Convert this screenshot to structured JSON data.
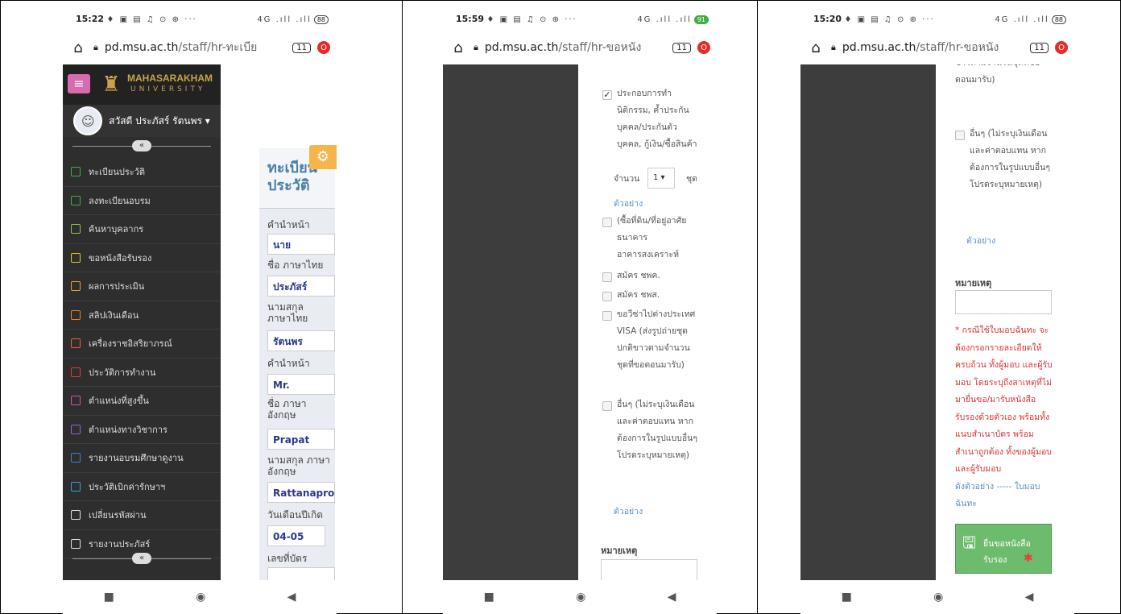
{
  "phones": [
    {
      "time": "15:22",
      "status_icons": "♦ ▣ ▤ ♫ ⊙ ⊕ ···",
      "signal": "4G .ıll .ıll",
      "battery": "88",
      "url_host": "pd.msu.ac.th",
      "url_path": "/staff/hr-ทะเบีย",
      "tab_count": "11"
    },
    {
      "time": "15:59",
      "status_icons": "♦ ▣ ▤ ♫ ⊙ ⊕ ···",
      "signal": "4G .ıll .ıll",
      "battery": "91",
      "url_host": "pd.msu.ac.th",
      "url_path": "/staff/hr-ขอหนัง",
      "tab_count": "11"
    },
    {
      "time": "15:20",
      "status_icons": "♦ ▣ ▤ ♫ ⊙ ⊕ ···",
      "signal": "4G .ıll .ıll",
      "battery": "88",
      "url_host": "pd.msu.ac.th",
      "url_path": "/staff/hr-ขอหนัง",
      "tab_count": "11"
    }
  ],
  "brand": {
    "name": "MAHASARAKHAM",
    "sub": "UNIVERSITY"
  },
  "user": {
    "greeting": "สวัสดี ประภัสร์ รัตนพร ▾"
  },
  "menu": [
    {
      "label": "ทะเบียนประวัติ",
      "color": "#3cb043"
    },
    {
      "label": "ลงทะเบียนอบรม",
      "color": "#3cb043"
    },
    {
      "label": "ค้นหาบุคลากร",
      "color": "#8bc34a"
    },
    {
      "label": "ขอหนังสือรับรอง",
      "color": "#e6c619"
    },
    {
      "label": "ผลการประเมิน",
      "color": "#f0a020"
    },
    {
      "label": "สลิปเงินเดือน",
      "color": "#f08020"
    },
    {
      "label": "เครื่องราชอิสริยาภรณ์",
      "color": "#f06030"
    },
    {
      "label": "ประวัติการทำงาน",
      "color": "#e53935"
    },
    {
      "label": "ตำแหน่งที่สูงขึ้น",
      "color": "#d84fb0"
    },
    {
      "label": "ตำแหน่งทางวิชาการ",
      "color": "#9c5fd8"
    },
    {
      "label": "รายงานอบรมศึกษาดูงาน",
      "color": "#3f7fd8"
    },
    {
      "label": "ประวัติเบิกค่ารักษาฯ",
      "color": "#29a6d8"
    },
    {
      "label": "เปลี่ยนรหัสผ่าน",
      "color": "#e0e0e0"
    },
    {
      "label": "รายงานประภัสร์",
      "color": "#e0e0e0"
    }
  ],
  "profile": {
    "title_line1": "ทะเบียน",
    "title_line2": "ประวัติ",
    "fields": [
      {
        "label": "คำนำหน้า",
        "value": "นาย"
      },
      {
        "label": "ชื่อ ภาษาไทย",
        "value": "ประภัสร์"
      },
      {
        "label": "นามสกุล ภาษาไทย",
        "value": "รัตนพร"
      },
      {
        "label": "คำนำหน้า",
        "value": "Mr."
      },
      {
        "label": "ชื่อ ภาษา อังกฤษ",
        "value": "Prapat"
      },
      {
        "label": "นามสกุล ภาษาอังกฤษ",
        "value": "Rattanaproı"
      },
      {
        "label": "วันเดือนปีเกิด",
        "value": "04-05"
      },
      {
        "label": "เลขที่บัตร",
        "value": ""
      }
    ]
  },
  "cert_form": {
    "item_loan": "ประกอบการทำนิติกรรม, ค้ำประกันบุคคล/ประกันตัวบุคคล, กู้เงิน/ซื้อสินค้า",
    "qty_label": "จำนวน",
    "qty_value": "1 ▾",
    "qty_unit": "ชุด",
    "example": "ตัวอย่าง",
    "item_land": "(ซื้อที่ดิน/ที่อยู่อาศัย ธนาคารอาคารสงเคราะห์",
    "item_cpk": "สมัคร ชพค.",
    "item_cps": "สมัคร ชพส.",
    "item_visa": "ขอวีซ่าไปต่างประเทศ VISA (ส่งรูปถ่ายชุดปกติขาวตามจำนวนชุดที่ขอตอนมารับ)",
    "item_other": "อื่นๆ (ไม่ระบุเงินเดือนและค่าตอบแทน หากต้องการในรูปแบบอื่นๆโปรดระบุหมายเหตุ)",
    "note_label": "หมายเหตุ",
    "red_note": "* กรณีใช้ใบมอบฉันทะ จะต้องกรอกรายละเอียดให้ครบถ้วน ทั้งผู้มอบ และผู้รับมอบ โดยระบุถึงสาเหตุที่ไม่มายื่นขอ/มารับหนังสือรับรองด้วยตัวเอง พร้อมทั้งแนบสำเนาบัตร พร้อมสำเนาถูกต้อง ทั้งของผู้มอบ และผู้รับมอบ",
    "proxy_link": "ดังตัวอย่าง ----- ใบมอบฉันทะ",
    "submit_label": "ยื่นขอหนังสือรับรอง",
    "submit_star": "✱"
  }
}
